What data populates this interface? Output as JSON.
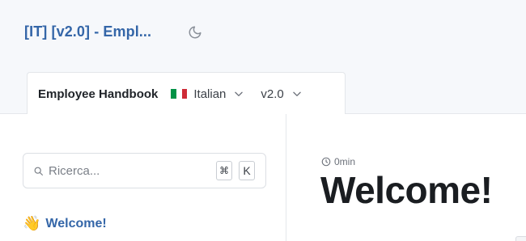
{
  "header": {
    "site_title": "[IT] [v2.0] - Empl...",
    "theme_icon": "moon-icon"
  },
  "selector": {
    "product": "Employee Handbook",
    "language": {
      "flag_icon": "italy-flag-icon",
      "label": "Italian",
      "flag_colors": [
        "#009246",
        "#ffffff",
        "#ce2b37"
      ]
    },
    "version": {
      "label": "v2.0"
    }
  },
  "sidebar": {
    "search": {
      "placeholder": "Ricerca...",
      "shortcut_keys": [
        "⌘",
        "K"
      ]
    },
    "items": [
      {
        "emoji": "👋",
        "label": "Welcome!"
      }
    ]
  },
  "main": {
    "read_time": "0min",
    "title": "Welcome!"
  },
  "colors": {
    "accent": "#3466a8",
    "header_bg": "#f6f8fb",
    "title_text": "#1a1d21"
  }
}
